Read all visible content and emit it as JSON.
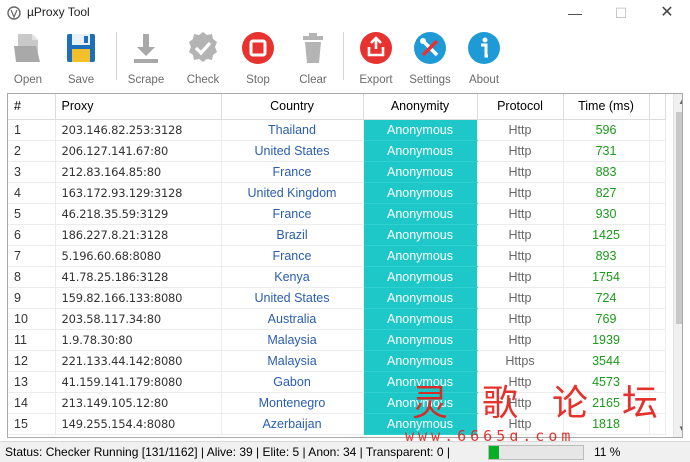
{
  "window": {
    "title": "µProxy Tool"
  },
  "toolbar": {
    "items": [
      {
        "label": "Open",
        "icon": "open-file-icon"
      },
      {
        "label": "Save",
        "icon": "floppy-disk-icon"
      },
      {
        "label": "Scrape",
        "icon": "download-arrow-icon"
      },
      {
        "label": "Check",
        "icon": "checkmark-badge-icon"
      },
      {
        "label": "Stop",
        "icon": "stop-icon"
      },
      {
        "label": "Clear",
        "icon": "trash-icon"
      },
      {
        "label": "Export",
        "icon": "export-icon"
      },
      {
        "label": "Settings",
        "icon": "tools-icon"
      },
      {
        "label": "About",
        "icon": "info-icon"
      }
    ]
  },
  "table": {
    "columns": [
      "#",
      "Proxy",
      "Country",
      "Anonymity",
      "Protocol",
      "Time (ms)"
    ],
    "rows": [
      {
        "num": "1",
        "proxy": "203.146.82.253:3128",
        "country": "Thailand",
        "anonymity": "Anonymous",
        "protocol": "Http",
        "time": "596"
      },
      {
        "num": "2",
        "proxy": "206.127.141.67:80",
        "country": "United States",
        "anonymity": "Anonymous",
        "protocol": "Http",
        "time": "731"
      },
      {
        "num": "3",
        "proxy": "212.83.164.85:80",
        "country": "France",
        "anonymity": "Anonymous",
        "protocol": "Http",
        "time": "883"
      },
      {
        "num": "4",
        "proxy": "163.172.93.129:3128",
        "country": "United Kingdom",
        "anonymity": "Anonymous",
        "protocol": "Http",
        "time": "827"
      },
      {
        "num": "5",
        "proxy": "46.218.35.59:3129",
        "country": "France",
        "anonymity": "Anonymous",
        "protocol": "Http",
        "time": "930"
      },
      {
        "num": "6",
        "proxy": "186.227.8.21:3128",
        "country": "Brazil",
        "anonymity": "Anonymous",
        "protocol": "Http",
        "time": "1425"
      },
      {
        "num": "7",
        "proxy": "5.196.60.68:8080",
        "country": "France",
        "anonymity": "Anonymous",
        "protocol": "Http",
        "time": "893"
      },
      {
        "num": "8",
        "proxy": "41.78.25.186:3128",
        "country": "Kenya",
        "anonymity": "Anonymous",
        "protocol": "Http",
        "time": "1754"
      },
      {
        "num": "9",
        "proxy": "159.82.166.133:8080",
        "country": "United States",
        "anonymity": "Anonymous",
        "protocol": "Http",
        "time": "724"
      },
      {
        "num": "10",
        "proxy": "203.58.117.34:80",
        "country": "Australia",
        "anonymity": "Anonymous",
        "protocol": "Http",
        "time": "769"
      },
      {
        "num": "11",
        "proxy": "1.9.78.30:80",
        "country": "Malaysia",
        "anonymity": "Anonymous",
        "protocol": "Http",
        "time": "1939"
      },
      {
        "num": "12",
        "proxy": "221.133.44.142:8080",
        "country": "Malaysia",
        "anonymity": "Anonymous",
        "protocol": "Https",
        "time": "3544"
      },
      {
        "num": "13",
        "proxy": "41.159.141.179:8080",
        "country": "Gabon",
        "anonymity": "Anonymous",
        "protocol": "Http",
        "time": "4573"
      },
      {
        "num": "14",
        "proxy": "213.149.105.12:80",
        "country": "Montenegro",
        "anonymity": "Anonymous",
        "protocol": "Http",
        "time": "2165"
      },
      {
        "num": "15",
        "proxy": "149.255.154.4:8080",
        "country": "Azerbaijan",
        "anonymity": "Anonymous",
        "protocol": "Http",
        "time": "1818"
      }
    ]
  },
  "status": {
    "text": "Status: Checker Running [131/1162] | Alive: 39 | Elite: 5 | Anon: 34 | Transparent: 0 |",
    "progress_fraction": 0.11,
    "percent_label": "11 %"
  },
  "watermark": {
    "chars": "灵歌论坛",
    "url": "www.6665q.com"
  },
  "colors": {
    "anonymity_bg": "#1ec8c8",
    "time_text": "#1a9a1a",
    "country_text": "#2a5db0",
    "progress_fill": "#06b025",
    "watermark": "#e2211c"
  }
}
